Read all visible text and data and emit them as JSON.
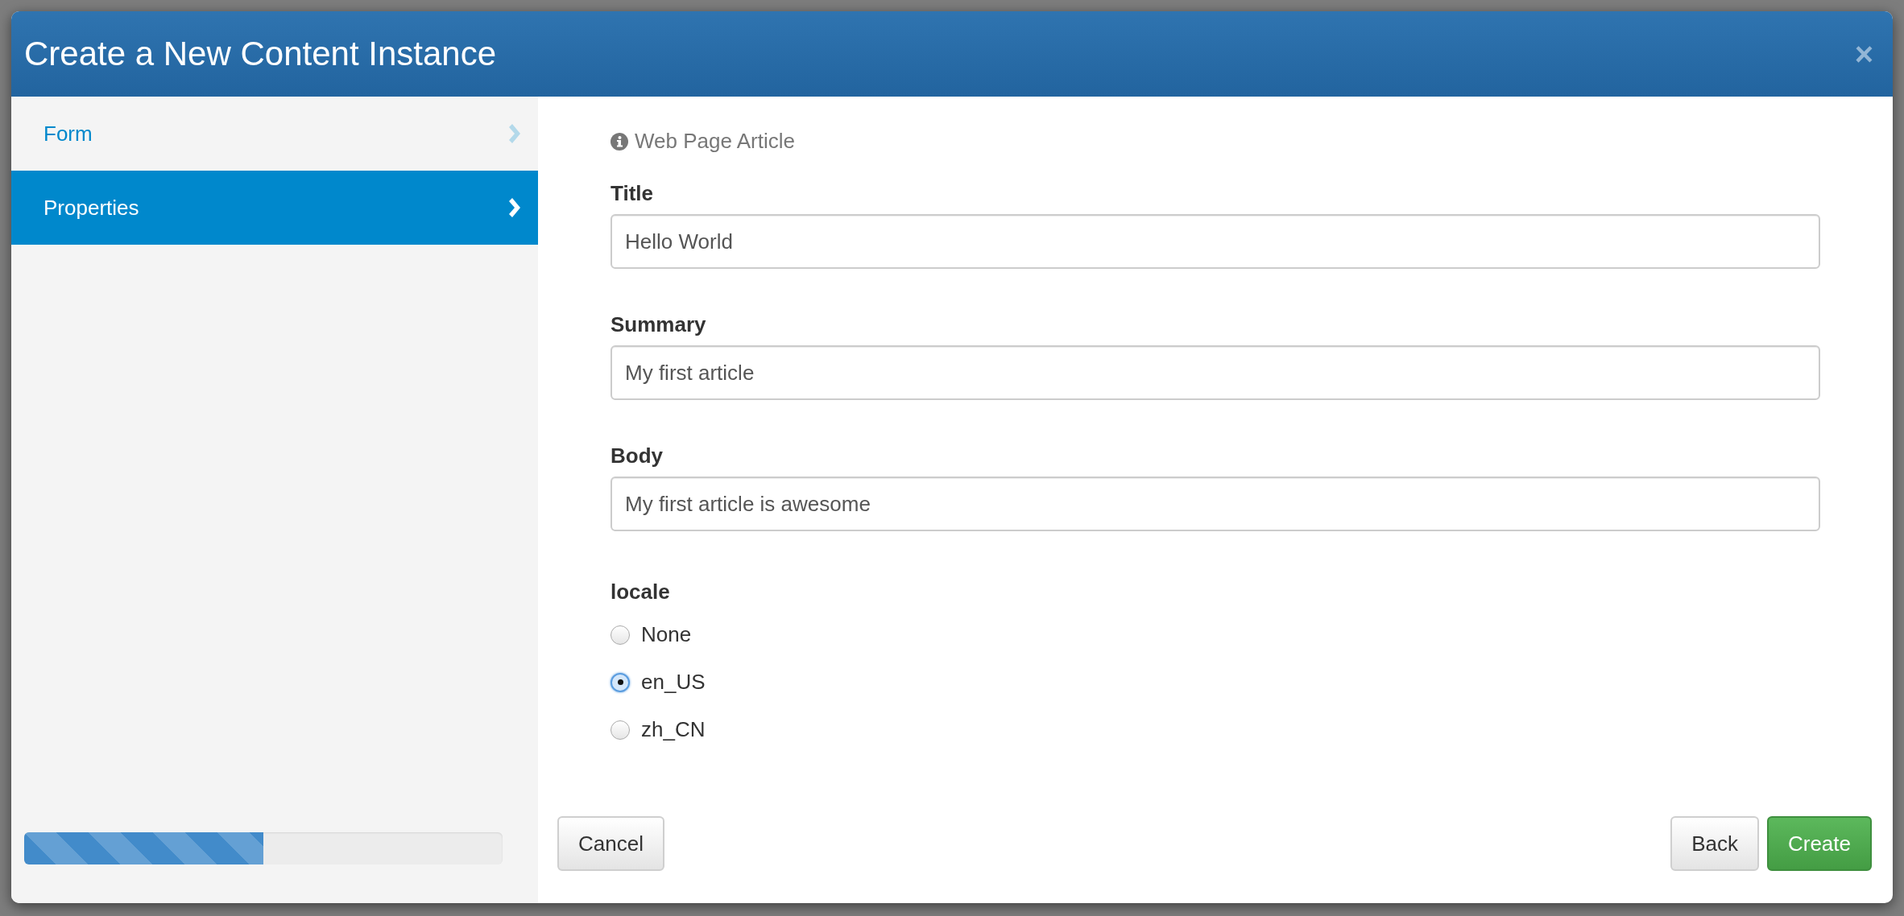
{
  "dialog": {
    "title": "Create a New Content Instance",
    "close": "×"
  },
  "steps": [
    {
      "label": "Form",
      "selected": false
    },
    {
      "label": "Properties",
      "selected": true
    }
  ],
  "progress": {
    "level": 0.5
  },
  "content_type": "Web Page Article",
  "fields": [
    {
      "label": "Title",
      "value": "Hello World"
    },
    {
      "label": "Summary",
      "value": "My first article"
    },
    {
      "label": "Body",
      "value": "My first article is awesome"
    }
  ],
  "locale": {
    "label": "locale",
    "options": [
      {
        "label": "None",
        "selected": false
      },
      {
        "label": "en_US",
        "selected": true
      },
      {
        "label": "zh_CN",
        "selected": false
      }
    ]
  },
  "buttons": [
    {
      "label": "Cancel",
      "kind": "default"
    },
    {
      "label": "Back",
      "kind": "default"
    },
    {
      "label": "Create",
      "kind": "primary"
    }
  ]
}
